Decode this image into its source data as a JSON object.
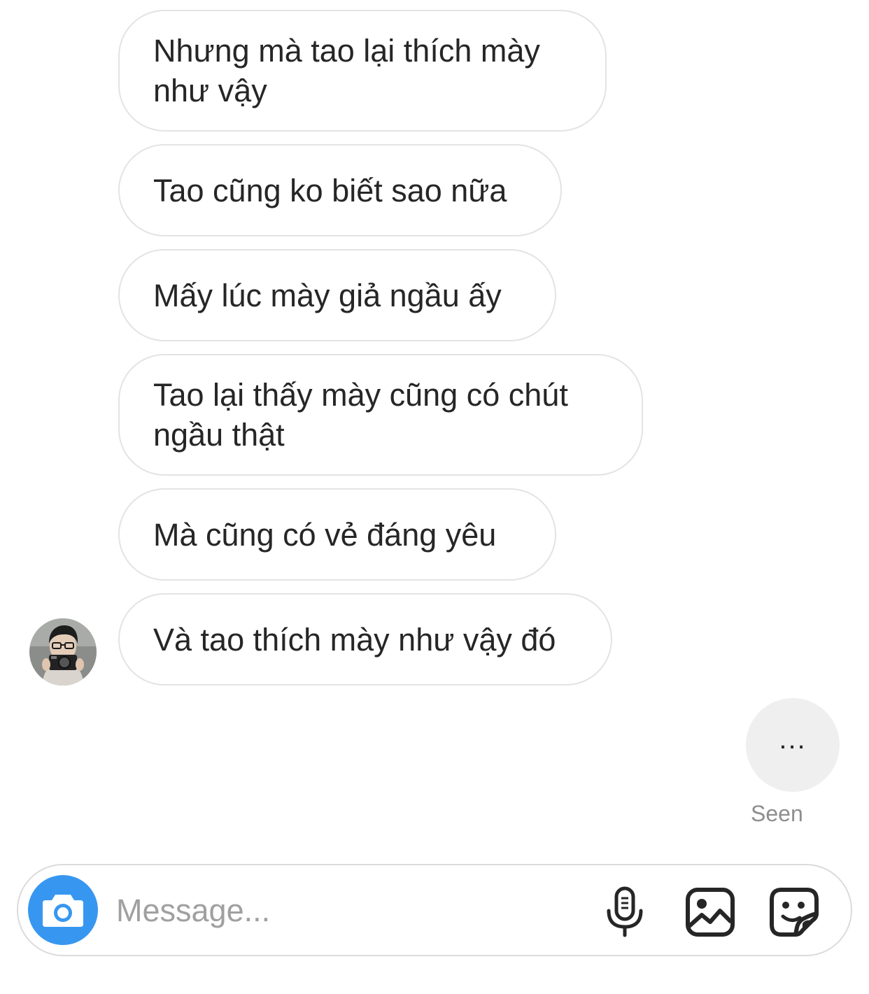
{
  "messages": [
    {
      "text": "Nhưng mà tao lại thích mày như vậy"
    },
    {
      "text": "Tao cũng ko biết sao nữa"
    },
    {
      "text": "Mấy lúc mày giả ngầu ấy"
    },
    {
      "text": "Tao lại thấy mày cũng có chút ngầu thật"
    },
    {
      "text": "Mà cũng có vẻ đáng yêu"
    },
    {
      "text": "Và tao thích mày như vậy đó"
    }
  ],
  "typing_indicator": {
    "text": "..."
  },
  "seen_label": "Seen",
  "composer": {
    "placeholder": "Message...",
    "value": "",
    "accent_color": "#3797f0",
    "icons": [
      "camera-icon",
      "microphone-icon",
      "gallery-icon",
      "sticker-icon"
    ]
  }
}
